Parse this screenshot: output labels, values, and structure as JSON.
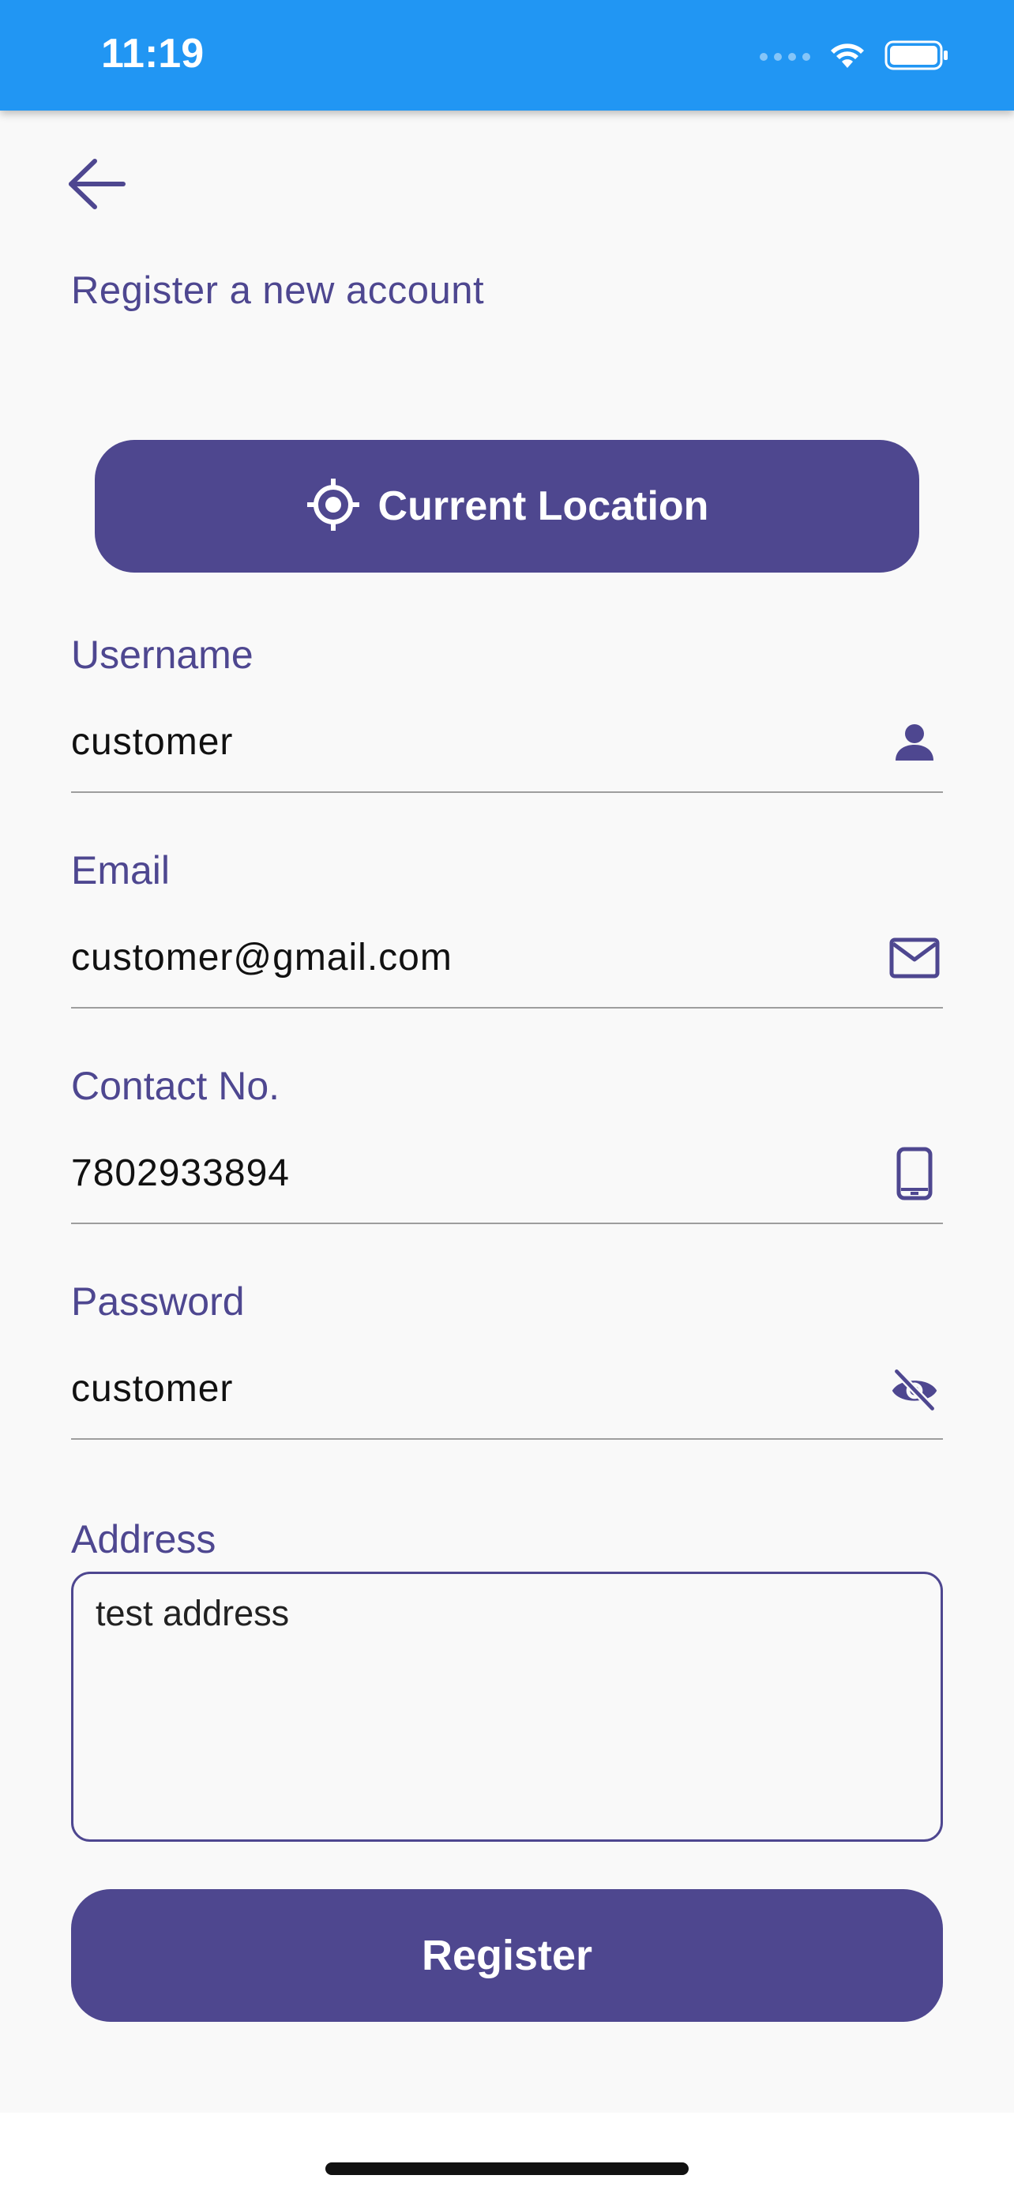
{
  "status_bar": {
    "time": "11:19",
    "icons": [
      "signal-icon",
      "wifi-icon",
      "battery-icon"
    ]
  },
  "header": {
    "back_icon": "arrow-left-icon",
    "title": "Register a new account"
  },
  "location_button": {
    "icon": "gps-target-icon",
    "label": "Current Location"
  },
  "form": {
    "username": {
      "label": "Username",
      "value": "customer",
      "icon": "person-icon"
    },
    "email": {
      "label": "Email",
      "value": "customer@gmail.com",
      "icon": "mail-icon"
    },
    "contact": {
      "label": "Contact No.",
      "value": "7802933894",
      "icon": "phone-icon"
    },
    "password": {
      "label": "Password",
      "value": "customer",
      "icon": "eye-off-icon"
    },
    "address": {
      "label": "Address",
      "value": "test address"
    }
  },
  "register_button": {
    "label": "Register"
  },
  "colors": {
    "status_bar": "#2196F3",
    "accent": "#4E478F",
    "background": "#F9F9F9"
  }
}
